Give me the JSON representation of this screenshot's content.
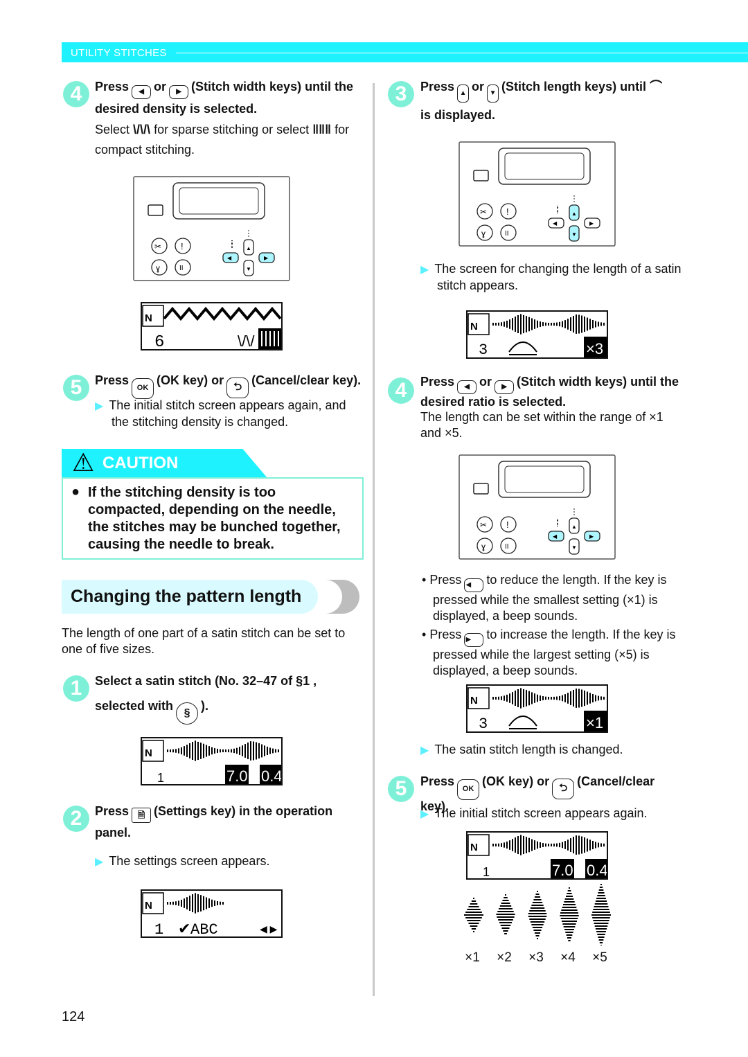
{
  "header": {
    "section": "UTILITY STITCHES"
  },
  "colors": {
    "accent": "#1ff2ff",
    "step_circle": "#7ff0d8",
    "key_highlight": "#aef6ff"
  },
  "left": {
    "step4": {
      "num": "4",
      "press": "Press",
      "or": "or",
      "rest": "(Stitch width keys) until the",
      "line2": "desired density is selected.",
      "select": "Select",
      "sparse": "for sparse stitching or select",
      "for": "for",
      "compact": "compact stitching."
    },
    "lcd1": {
      "number": "6"
    },
    "step5": {
      "num": "5",
      "press": "Press",
      "ok": "OK",
      "ok_label": "(OK key) or",
      "cancel_label": "(Cancel/clear key).",
      "result": "The initial stitch screen appears again, and the stitching density is changed."
    },
    "caution": {
      "title": "CAUTION",
      "text": "If the stitching density is too compacted, depending on the needle, the stitches may be bunched together, causing the needle to break."
    },
    "section_title": "Changing the pattern length",
    "intro": "The length of one part of a satin stitch can be set to one of five sizes.",
    "step1": {
      "num": "1",
      "text": "Select a satin stitch (No. 32–47 of",
      "cat": "1 ,",
      "line2": "selected with",
      "close": ")."
    },
    "lcd_s1": {
      "category": "1",
      "width": "7.0",
      "length": "0.4"
    },
    "step2": {
      "num": "2",
      "press": "Press",
      "rest": "(Settings key) in the operation",
      "line2": "panel.",
      "result": "The settings screen appears."
    },
    "lcd_s2": {
      "page": "1",
      "value": "ABC"
    }
  },
  "right": {
    "step3": {
      "num": "3",
      "press": "Press",
      "or": "or",
      "rest": "(Stitch length keys) until",
      "line2": "is displayed.",
      "result": "The screen for changing the length of a satin stitch appears."
    },
    "lcd_r1": {
      "number": "3",
      "ratio": "×3"
    },
    "step4": {
      "num": "4",
      "press": "Press",
      "or": "or",
      "rest": "(Stitch width keys) until the",
      "line2": "desired ratio is selected.",
      "note1": "The length can be set within the range of",
      "min": "×1",
      "and": "and",
      "max": "×5",
      "dot": "."
    },
    "bullets": [
      {
        "pre": "Press",
        "post": "to reduce the length. If the key is pressed while the smallest setting (×1) is displayed, a beep sounds."
      },
      {
        "pre": "Press",
        "post": "to increase the length. If the key is pressed while the largest setting (×5) is displayed, a beep sounds."
      }
    ],
    "lcd_r2": {
      "number": "3",
      "ratio": "×1"
    },
    "result2": "The satin stitch length is changed.",
    "step5": {
      "num": "5",
      "press": "Press",
      "ok": "OK",
      "ok_label": "(OK key) or",
      "cancel_label": "(Cancel/clear",
      "line2": "key).",
      "result": "The initial stitch screen appears again."
    },
    "lcd_r3": {
      "category": "1",
      "width": "7.0",
      "length": "0.4"
    },
    "sizes": [
      "×1",
      "×2",
      "×3",
      "×4",
      "×5"
    ]
  },
  "page_number": "124"
}
